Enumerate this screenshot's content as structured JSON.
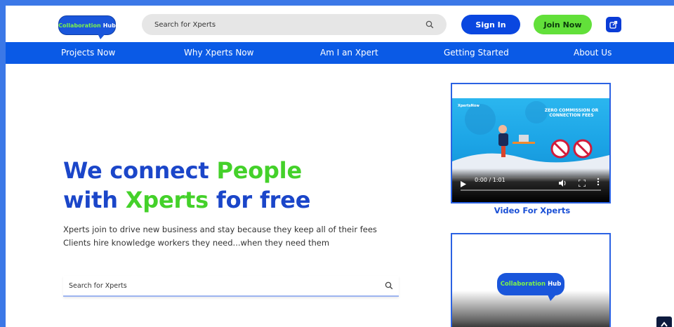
{
  "header": {
    "logo_word1": "Collaboration",
    "logo_word2": "Hub",
    "search_placeholder": "Search for Xperts",
    "signin_label": "Sign In",
    "join_label": "Join Now"
  },
  "nav": {
    "items": [
      {
        "label": "Projects Now"
      },
      {
        "label": "Why Xperts Now"
      },
      {
        "label": "Am I an Xpert"
      },
      {
        "label": "Getting Started"
      },
      {
        "label": "About Us"
      }
    ]
  },
  "hero": {
    "line1_a": "We connect ",
    "line1_b": "People",
    "line2_a": "with ",
    "line2_b": "Xperts",
    "line2_c": " for free",
    "subtitle1": "Xperts join to drive new business and stay because they keep all of their fees",
    "subtitle2": "Clients hire knowledge workers they need...when they need them",
    "search_placeholder": "Search for Xperts"
  },
  "video1": {
    "brand": "XpertsNow",
    "headline": "ZERO COMMISSION OR CONNECTION FEES",
    "time": "0:00 / 1:01",
    "label": "Video For Xperts"
  },
  "video2": {
    "logo_word1": "Collaboration",
    "logo_word2": "Hub"
  },
  "colors": {
    "primary_blue": "#0a5ae6",
    "accent_green": "#62e03a",
    "title_blue": "#1b46c9"
  }
}
